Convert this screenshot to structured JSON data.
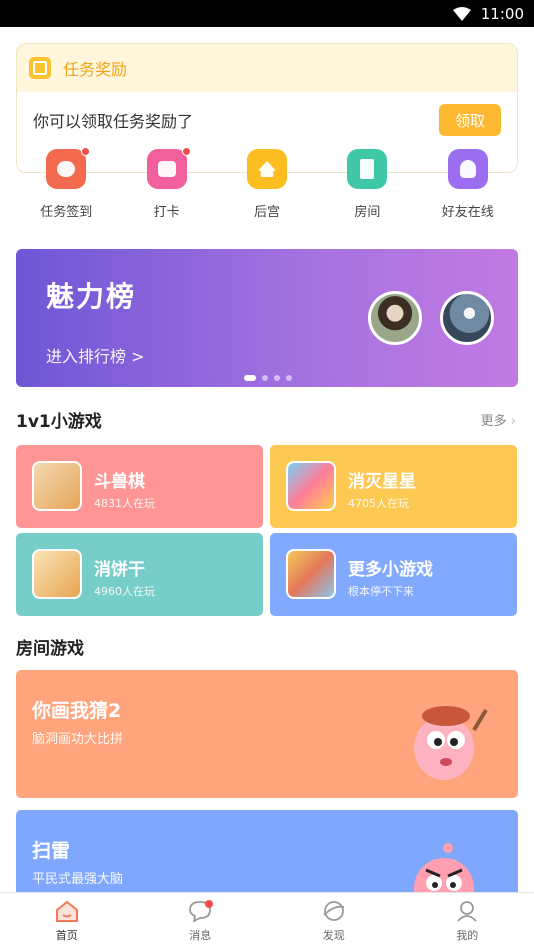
{
  "status": {
    "time": "11:00"
  },
  "task": {
    "title": "任务奖励",
    "message": "你可以领取任务奖励了",
    "claim": "领取"
  },
  "quick": [
    {
      "label": "任务签到",
      "color": "#f36a4f",
      "badge": true
    },
    {
      "label": "打卡",
      "color": "#f25f9d",
      "badge": true
    },
    {
      "label": "后宫",
      "color": "#fbbd20",
      "badge": false
    },
    {
      "label": "房间",
      "color": "#3ec8a8",
      "badge": false
    },
    {
      "label": "好友在线",
      "color": "#9b6df1",
      "badge": false
    }
  ],
  "banner": {
    "title": "魅力榜",
    "subtitle": "进入排行榜 >"
  },
  "mini": {
    "title": "1v1小游戏",
    "more": "更多",
    "games": [
      {
        "name": "斗兽棋",
        "sub": "4831人在玩",
        "color": "#ff9595"
      },
      {
        "name": "消灭星星",
        "sub": "4705人在玩",
        "color": "#fec953"
      },
      {
        "name": "消饼干",
        "sub": "4960人在玩",
        "color": "#77cdc7"
      },
      {
        "name": "更多小游戏",
        "sub": "根本停不下来",
        "color": "#81a9fd"
      }
    ]
  },
  "rooms": {
    "title": "房间游戏",
    "items": [
      {
        "name": "你画我猜2",
        "sub": "脑洞画功大比拼",
        "color": "#ffa47d"
      },
      {
        "name": "扫雷",
        "sub": "平民式最强大脑",
        "color": "#7ea7fd"
      }
    ]
  },
  "tabs": [
    {
      "label": "首页",
      "active": true
    },
    {
      "label": "消息",
      "active": false
    },
    {
      "label": "发现",
      "active": false
    },
    {
      "label": "我的",
      "active": false
    }
  ]
}
